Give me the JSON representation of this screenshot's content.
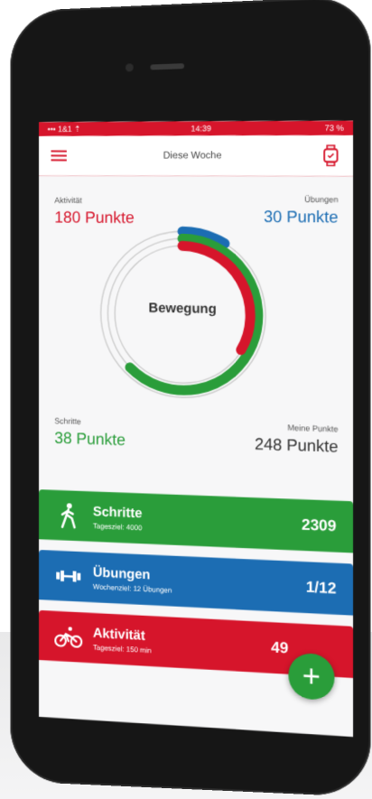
{
  "colors": {
    "red": "#d6152b",
    "green": "#2a9d3a",
    "blue": "#1c6db3"
  },
  "statusbar": {
    "carrier": "••• 1&1 ⇡",
    "time": "14:39",
    "battery": "73 %"
  },
  "header": {
    "title": "Diese Woche",
    "menu_icon": "hamburger-icon",
    "watch_icon": "smartwatch-icon"
  },
  "stats": {
    "aktivitaet": {
      "label": "Aktivität",
      "value": "180 Punkte",
      "color": "#d6152b"
    },
    "uebungen": {
      "label": "Übungen",
      "value": "30 Punkte",
      "color": "#1c6db3"
    },
    "schritte": {
      "label": "Schritte",
      "value": "38 Punkte",
      "color": "#2a9d3a"
    },
    "meine_punkte": {
      "label": "Meine Punkte",
      "value": "248 Punkte",
      "color": "#333333"
    },
    "ring_center": "Bewegung"
  },
  "cards": [
    {
      "title": "Schritte",
      "sub": "Tagesziel: 4000",
      "value": "2309",
      "icon": "walking-icon",
      "color": "#2a9d3a"
    },
    {
      "title": "Übungen",
      "sub": "Wochenziel: 12 Übungen",
      "value": "1/12",
      "icon": "dumbbell-icon",
      "color": "#1c6db3"
    },
    {
      "title": "Aktivität",
      "sub": "Tagesziel: 150 min",
      "value": "49",
      "icon": "bicycle-icon",
      "color": "#d6152b"
    }
  ],
  "fab": {
    "label": "+"
  }
}
